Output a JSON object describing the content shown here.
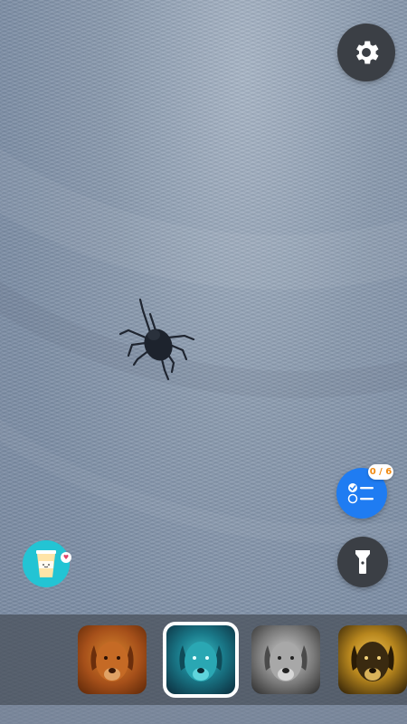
{
  "camera_view": {
    "subject": "tick-on-fur"
  },
  "controls": {
    "settings_icon": "gear-icon",
    "checklist_icon": "checklist-icon",
    "checklist_progress": "0 / 6",
    "flashlight_icon": "flashlight-icon",
    "coffee_icon": "coffee-cup-icon",
    "coffee_badge_icon": "heart-icon"
  },
  "filters": {
    "items": [
      {
        "name": "filter-amber-dog",
        "color": "#a6501a",
        "selected": false
      },
      {
        "name": "filter-cyan-dog",
        "color": "#1a7a8a",
        "selected": true
      },
      {
        "name": "filter-gray-dog",
        "color": "#7a7a7a",
        "selected": false
      },
      {
        "name": "filter-gold-dog",
        "color": "#b8871e",
        "selected": false
      }
    ]
  },
  "colors": {
    "checklist_blue": "#1f7cf2",
    "badge_orange": "#f08a12",
    "coffee_teal": "#23c4d4",
    "dark_button": "#3b3f45"
  }
}
